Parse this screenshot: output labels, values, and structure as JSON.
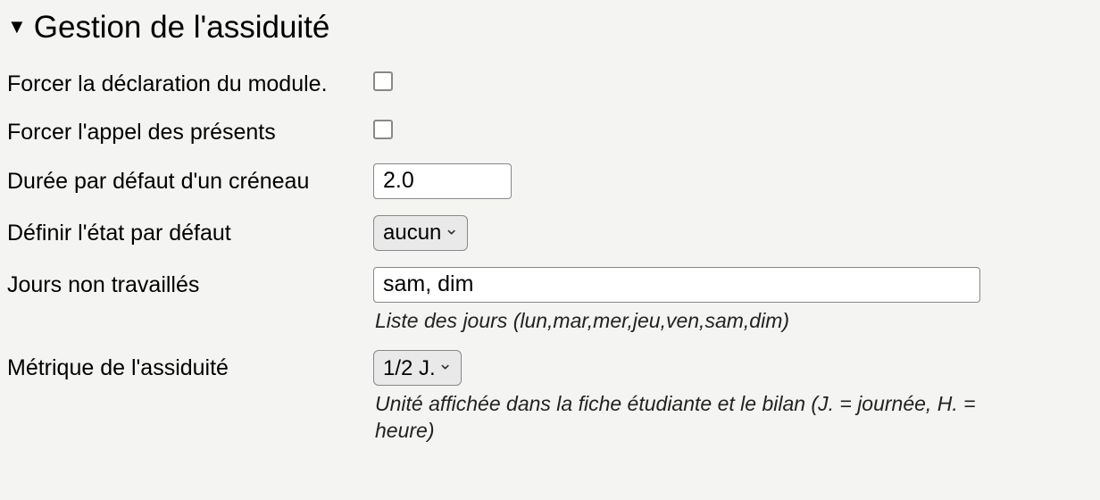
{
  "section": {
    "title": "Gestion de l'assiduité"
  },
  "fields": {
    "force_module": {
      "label": "Forcer la déclaration du module.",
      "checked": false
    },
    "force_roll": {
      "label": "Forcer l'appel des présents",
      "checked": false
    },
    "default_duration": {
      "label": "Durée par défaut d'un créneau",
      "value": "2.0"
    },
    "default_state": {
      "label": "Définir l'état par défaut",
      "value": "aucun"
    },
    "non_working_days": {
      "label": "Jours non travaillés",
      "value": "sam, dim",
      "helper": "Liste des jours (lun,mar,mer,jeu,ven,sam,dim)"
    },
    "attendance_metric": {
      "label": "Métrique de l'assiduité",
      "value": "1/2 J.",
      "helper": "Unité affichée dans la fiche étudiante et le bilan (J. = journée, H. = heure)"
    }
  }
}
